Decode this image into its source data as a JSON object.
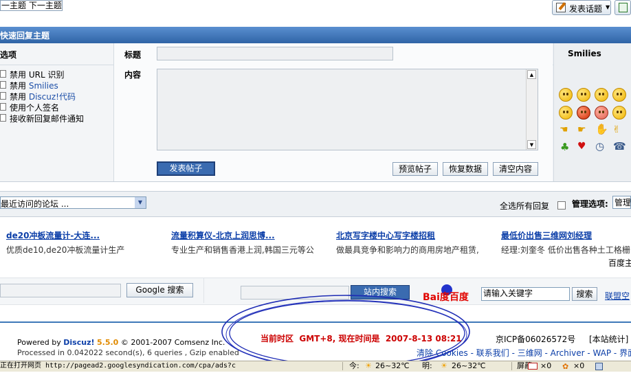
{
  "topnav": {
    "prev_next": "一主题 下一主题"
  },
  "toolbar": {
    "new_topic": "发表话题"
  },
  "quick_reply": {
    "header": "快速回复主题",
    "options_label": "选项",
    "title_label": "标题",
    "content_label": "内容",
    "smilies_label": "Smilies",
    "options": [
      {
        "pre": "禁用 ",
        "link": "",
        "text": "URL 识别"
      },
      {
        "pre": "禁用 ",
        "link": "Smilies",
        "text": ""
      },
      {
        "pre": "禁用 ",
        "link": "Discuz!代码",
        "text": ""
      },
      {
        "pre": "",
        "link": "",
        "text": "使用个人签名"
      },
      {
        "pre": "",
        "link": "",
        "text": "接收新回复邮件通知"
      }
    ],
    "submit": "发表帖子",
    "preview": "预览帖子",
    "restore": "恢复数据",
    "clear": "清空内容"
  },
  "bar": {
    "forum_jump": "最近访问的论坛 ...",
    "select_all": "全选所有回复",
    "admin_label": "管理选项:",
    "admin_select": "管理"
  },
  "ads": [
    {
      "title": "de20冲板流量计-大连...",
      "desc": "优质de10,de20冲板流量计生产"
    },
    {
      "title": "流量积算仪-北京上润思博...",
      "desc": "专业生产和销售香港上润,韩国三元等公"
    },
    {
      "title": "北京写字楼中心写字楼招租",
      "desc": "做最具竞争和影响力的商用房地产租赁,"
    },
    {
      "title": "最低价出售三维网刘经理",
      "desc": "经理:刘奎冬  低价出售各种土工格栅"
    }
  ],
  "ads_footer": "百度主",
  "search": {
    "google_btn": "Google 搜索",
    "site_btn": "站内搜索",
    "baidu_placeholder": "请输入关键字",
    "baidu_btn": "搜索",
    "baidu_logo": "Bai度百度",
    "union": "联盟空"
  },
  "footer": {
    "powered_pre": "Powered by ",
    "powered_name": "Discuz!",
    "powered_ver": "5.5.0",
    "copyright": "© 2001-2007 Comsenz Inc.",
    "processed": "Processed in 0.042022 second(s), 6 queries , Gzip enabled",
    "timezone": "当前时区  GMT+8, 现在时间是  2007-8-13 08:21",
    "icp": "京ICP备06026572号",
    "stats": "[本站统计]",
    "links": "清除 Cookies - 联系我们 - 三维网 - Archiver - WAP - 界面"
  },
  "statusbar": {
    "loading": "正在打开网页 http://pagead2.googlesyndication.com/cpa/ads?c",
    "today": "今:",
    "today_temp": "26~32℃",
    "tomorrow": "明:",
    "tomorrow_temp": "26~32℃",
    "screen_label": "屏蔽:",
    "count1": "×0",
    "count2": "×0"
  },
  "colors": {
    "header_blue": "#3e78b8",
    "timezone_red": "#cc0000",
    "oval": "#1e2cb4"
  }
}
